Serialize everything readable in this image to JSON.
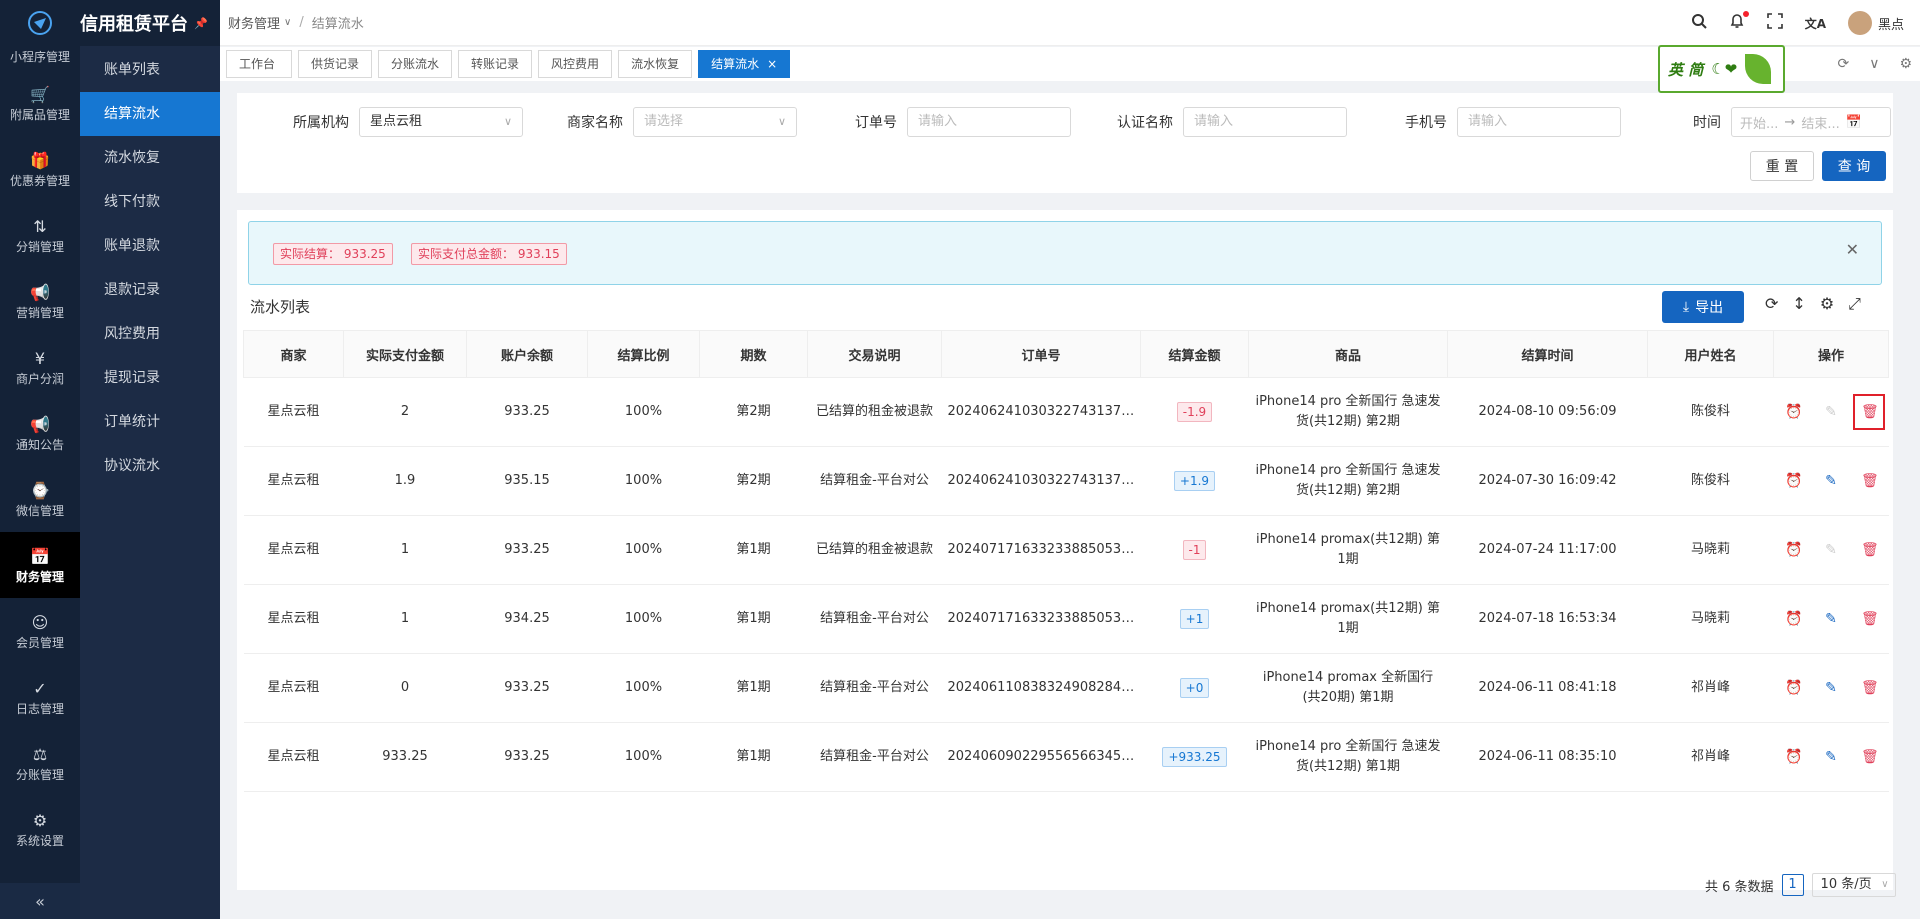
{
  "brand": {
    "title": "信用租赁平台"
  },
  "rail": [
    {
      "label": "小程序管理",
      "icon": "app-icon"
    },
    {
      "label": "附属品管理",
      "icon": "cart-icon"
    },
    {
      "label": "优惠券管理",
      "icon": "gift-icon"
    },
    {
      "label": "分销管理",
      "icon": "share-icon"
    },
    {
      "label": "营销管理",
      "icon": "megaphone-icon"
    },
    {
      "label": "商户分润",
      "icon": "yen-icon"
    },
    {
      "label": "通知公告",
      "icon": "notice-icon"
    },
    {
      "label": "微信管理",
      "icon": "wechat-icon"
    },
    {
      "label": "财务管理",
      "icon": "finance-icon"
    },
    {
      "label": "会员管理",
      "icon": "member-icon"
    },
    {
      "label": "日志管理",
      "icon": "log-icon"
    },
    {
      "label": "分账管理",
      "icon": "split-icon"
    },
    {
      "label": "系统设置",
      "icon": "settings-icon"
    }
  ],
  "submenu": [
    "账单列表",
    "结算流水",
    "流水恢复",
    "线下付款",
    "账单退款",
    "退款记录",
    "风控费用",
    "提现记录",
    "订单统计",
    "协议流水"
  ],
  "breadcrumb": {
    "parent": "财务管理",
    "current": "结算流水"
  },
  "user": {
    "name": "黑点"
  },
  "tabs": [
    "工作台",
    "供货记录",
    "分账流水",
    "转账记录",
    "风控费用",
    "流水恢复",
    "结算流水"
  ],
  "ime": {
    "text": "英 简"
  },
  "search": {
    "org_label": "所属机构",
    "org_value": "星点云租",
    "merchant_label": "商家名称",
    "merchant_placeholder": "请选择",
    "order_label": "订单号",
    "order_placeholder": "请输入",
    "auth_label": "认证名称",
    "auth_placeholder": "请输入",
    "phone_label": "手机号",
    "phone_placeholder": "请输入",
    "time_label": "时间",
    "time_start": "开始...",
    "time_arrow": "→",
    "time_end": "结束...",
    "reset": "重 置",
    "query": "查 询"
  },
  "alert": {
    "actual_settle": "实际结算： 933.25",
    "actual_paid": "实际支付总金额： 933.15"
  },
  "list": {
    "title": "流水列表",
    "export": "导出"
  },
  "table": {
    "headers": [
      "商家",
      "实际支付金额",
      "账户余额",
      "结算比例",
      "期数",
      "交易说明",
      "订单号",
      "结算金额",
      "商品",
      "结算时间",
      "用户姓名",
      "操作"
    ],
    "rows": [
      {
        "merchant": "星点云租",
        "paid": "2",
        "balance": "933.25",
        "ratio": "100%",
        "period": "第2期",
        "desc": "已结算的租金被退款",
        "order": "2024062410303227431376...",
        "amount": "-1.9",
        "sign": "neg",
        "product": "iPhone14 pro 全新国行 急速发货(共12期) 第2期",
        "time": "2024-08-10 09:56:09",
        "user": "陈俊科",
        "active": false
      },
      {
        "merchant": "星点云租",
        "paid": "1.9",
        "balance": "935.15",
        "ratio": "100%",
        "period": "第2期",
        "desc": "结算租金-平台对公",
        "order": "2024062410303227431376...",
        "amount": "+1.9",
        "sign": "pos",
        "product": "iPhone14 pro 全新国行 急速发货(共12期) 第2期",
        "time": "2024-07-30 16:09:42",
        "user": "陈俊科",
        "active": true
      },
      {
        "merchant": "星点云租",
        "paid": "1",
        "balance": "933.25",
        "ratio": "100%",
        "period": "第1期",
        "desc": "已结算的租金被退款",
        "order": "2024071716332338850531...",
        "amount": "-1",
        "sign": "neg",
        "product": "iPhone14 promax(共12期) 第1期",
        "time": "2024-07-24 11:17:00",
        "user": "马晓莉",
        "active": false
      },
      {
        "merchant": "星点云租",
        "paid": "1",
        "balance": "934.25",
        "ratio": "100%",
        "period": "第1期",
        "desc": "结算租金-平台对公",
        "order": "2024071716332338850531...",
        "amount": "+1",
        "sign": "pos",
        "product": "iPhone14 promax(共12期) 第1期",
        "time": "2024-07-18 16:53:34",
        "user": "马晓莉",
        "active": true
      },
      {
        "merchant": "星点云租",
        "paid": "0",
        "balance": "933.25",
        "ratio": "100%",
        "period": "第1期",
        "desc": "结算租金-平台对公",
        "order": "2024061108383249082842...",
        "amount": "+0",
        "sign": "pos",
        "product": "iPhone14 promax 全新国行(共20期) 第1期",
        "time": "2024-06-11 08:41:18",
        "user": "祁肖峰",
        "active": true
      },
      {
        "merchant": "星点云租",
        "paid": "933.25",
        "balance": "933.25",
        "ratio": "100%",
        "period": "第1期",
        "desc": "结算租金-平台对公",
        "order": "2024060902295565663458...",
        "amount": "+933.25",
        "sign": "pos",
        "product": "iPhone14 pro 全新国行 急速发货(共12期) 第1期",
        "time": "2024-06-11 08:35:10",
        "user": "祁肖峰",
        "active": true
      }
    ]
  },
  "pager": {
    "total": "共 6 条数据",
    "page": "1",
    "size": "10 条/页"
  },
  "colors": {
    "primary": "#1565c0",
    "rail_bg": "#142237",
    "submenu_bg": "#1c2b45",
    "danger": "#e0405a"
  }
}
